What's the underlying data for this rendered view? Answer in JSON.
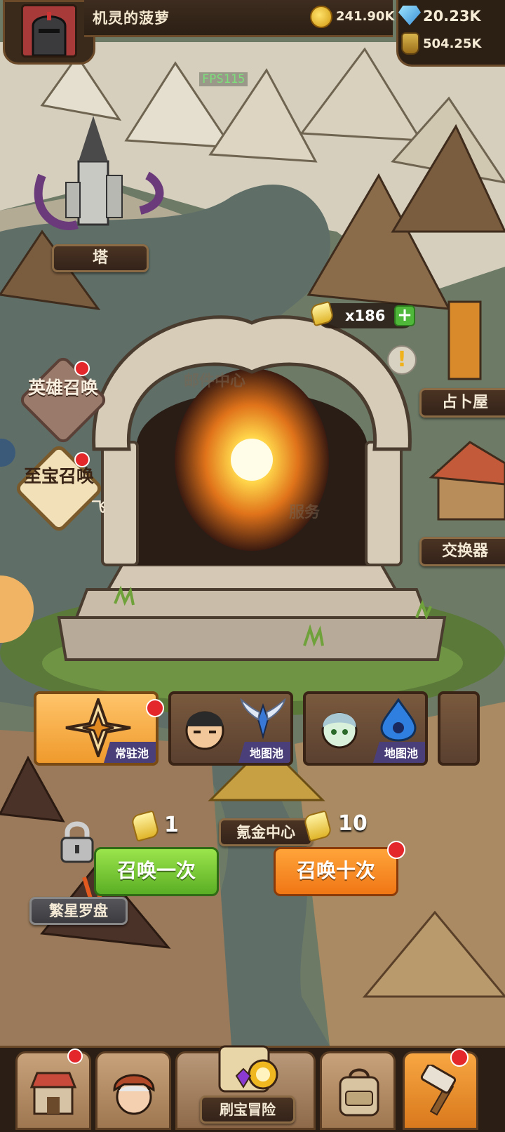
{
  "player": {
    "name": "机灵的菠萝"
  },
  "resources": {
    "gold": "241.90K",
    "gems": "20.23K",
    "potion": "504.25K"
  },
  "debug": {
    "fps": "FPS115"
  },
  "map_labels": {
    "tower": "塔",
    "fortune_house": "占卜屋",
    "exchanger": "交换器",
    "krypton_center": "氪金中心",
    "star_compass": "繁星罗盘",
    "mail_center_partial": "邮件中心",
    "service_partial": "服务",
    "fly_partial": "飞"
  },
  "summon_scrolls": {
    "count": "x186"
  },
  "side_buttons": {
    "hero_summon": "英雄召唤",
    "treasure_summon": "至宝召唤"
  },
  "pools": [
    {
      "label": "常驻池",
      "selected": true
    },
    {
      "label": "地图池",
      "selected": false
    },
    {
      "label": "地图池",
      "selected": false
    }
  ],
  "summon": {
    "once_label": "召唤一次",
    "once_cost": "1",
    "ten_label": "召唤十次",
    "ten_cost": "10"
  },
  "bottom_nav": {
    "adventure_label": "刷宝冒险"
  },
  "colors": {
    "green_button": "#7fd23a",
    "orange_button": "#ff8a1f",
    "badge_red": "#e3272b",
    "pool_tag": "#4b3f7a"
  }
}
